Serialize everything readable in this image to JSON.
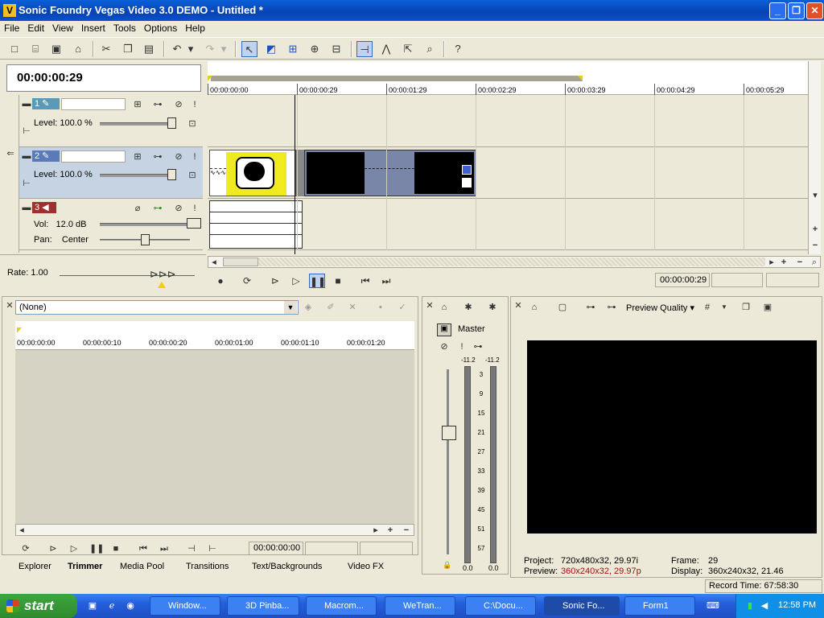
{
  "window": {
    "title": "Sonic Foundry Vegas Video 3.0 DEMO - Untitled *",
    "app_icon": "V"
  },
  "menu": [
    "File",
    "Edit",
    "View",
    "Insert",
    "Tools",
    "Options",
    "Help"
  ],
  "toolbar_icons": [
    "new-icon",
    "open-icon",
    "save-icon",
    "properties-icon",
    "cut-icon",
    "copy-icon",
    "paste-icon",
    "undo-icon",
    "redo-icon",
    "normal-edit-tool-icon",
    "envelope-tool-icon",
    "selection-tool-icon",
    "zoom-tool-icon",
    "snapping-icon",
    "auto-crossfade-icon",
    "ripple-edit-icon",
    "lock-envelopes-icon",
    "ignore-grouping-icon",
    "help-icon"
  ],
  "time_display": "00:00:00:29",
  "tracks": [
    {
      "num": "1",
      "level_label": "Level:",
      "level_value": "100.0 %",
      "level": 1.0,
      "color": "#5a9ab8"
    },
    {
      "num": "2",
      "level_label": "Level:",
      "level_value": "100.0 %",
      "level": 1.0,
      "color": "#5a7ab8"
    },
    {
      "num": "3",
      "vol_label": "Vol:",
      "vol_value": "12.0 dB",
      "pan_label": "Pan:",
      "pan_value": "Center",
      "color": "#a03030"
    }
  ],
  "rate": {
    "label": "Rate: 1.00"
  },
  "ruler": [
    "00:00:00:00",
    "00:00:00:29",
    "00:00:01:29",
    "00:00:02:29",
    "00:00:03:29",
    "00:00:04:29",
    "00:00:05:29"
  ],
  "transport": {
    "time": "00:00:00:29"
  },
  "trimmer": {
    "dropdown": "(None)",
    "ruler": [
      "00:00:00:00",
      "00:00:00:10",
      "00:00:00:20",
      "00:00:01:00",
      "00:00:01:10",
      "00:00:01:20"
    ],
    "time": "00:00:00:00"
  },
  "tabs": [
    "Explorer",
    "Trimmer",
    "Media Pool",
    "Transitions",
    "Text/Backgrounds",
    "Video FX"
  ],
  "active_tab": "Trimmer",
  "mixer": {
    "label": "Master",
    "peak_left": "-11.2",
    "peak_right": "-11.2",
    "scale": [
      "3",
      "9",
      "15",
      "21",
      "27",
      "33",
      "39",
      "45",
      "51",
      "57"
    ],
    "bottom_left": "0.0",
    "bottom_right": "0.0"
  },
  "preview": {
    "quality_label": "Preview Quality",
    "project_label": "Project:",
    "project_value": "720x480x32, 29.97i",
    "preview_label": "Preview:",
    "preview_value": "360x240x32, 29.97p",
    "frame_label": "Frame:",
    "frame_value": "29",
    "display_label": "Display:",
    "display_value": "360x240x32, 21.46"
  },
  "status": {
    "record_time": "Record Time: 67:58:30"
  },
  "taskbar": {
    "start": "start",
    "tasks": [
      "Window...",
      "3D Pinba...",
      "Macrom...",
      "WeTran...",
      "C:\\Docu...",
      "Sonic Fo...",
      "Form1"
    ],
    "active_task": 5,
    "clock": "12:58 PM"
  }
}
